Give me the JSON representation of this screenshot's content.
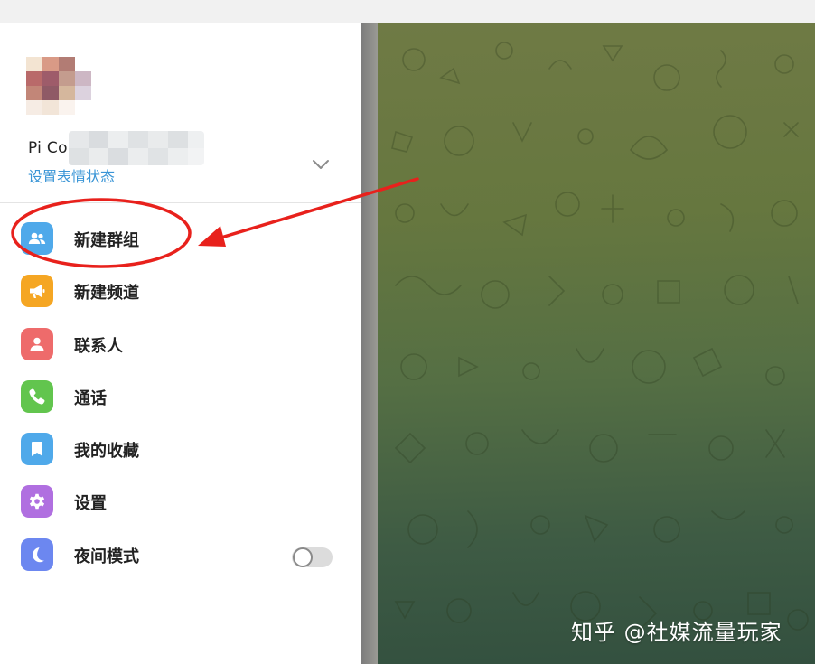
{
  "profile": {
    "name_visible": "Pi Co",
    "status_link": "设置表情状态"
  },
  "menu": [
    {
      "label": "新建群组",
      "icon": "group-icon",
      "color": "#4fa9ea"
    },
    {
      "label": "新建频道",
      "icon": "megaphone-icon",
      "color": "#f5a623"
    },
    {
      "label": "联系人",
      "icon": "person-icon",
      "color": "#ee6b6b"
    },
    {
      "label": "通话",
      "icon": "phone-icon",
      "color": "#62c54e"
    },
    {
      "label": "我的收藏",
      "icon": "bookmark-icon",
      "color": "#4fa9ea"
    },
    {
      "label": "设置",
      "icon": "gear-icon",
      "color": "#b06fe0"
    },
    {
      "label": "夜间模式",
      "icon": "moon-icon",
      "color": "#6c87f0"
    }
  ],
  "night_mode": {
    "enabled": false
  },
  "annotation": {
    "color": "#e8211c"
  },
  "watermark": "知乎 @社媒流量玩家"
}
